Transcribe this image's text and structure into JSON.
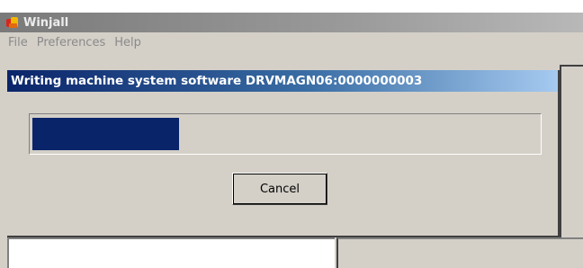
{
  "app": {
    "title": "Winjall",
    "icon": "winjall-app-icon"
  },
  "menu": {
    "items": [
      "File",
      "Preferences",
      "Help"
    ]
  },
  "dialog": {
    "title": "Writing machine system software DRVMAGN06:0000000003",
    "progress_fraction": 0.29,
    "cancel_label": "Cancel"
  },
  "colors": {
    "progress_fill": "#0a246a",
    "dialog_title_start": "#0a246a",
    "dialog_title_end": "#a6caf0",
    "window_face": "#d4d0c8"
  }
}
